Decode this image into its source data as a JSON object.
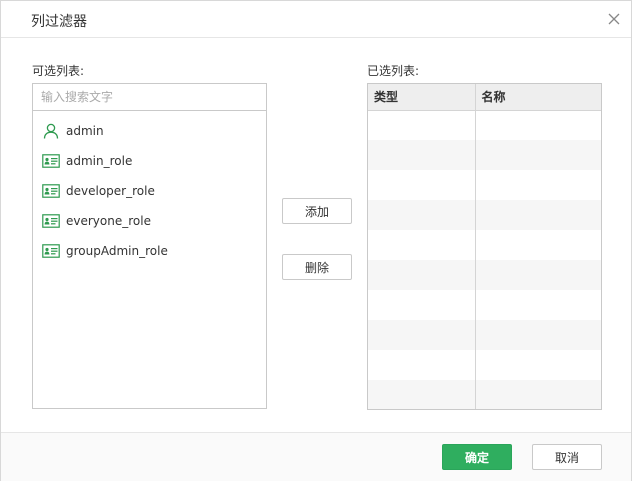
{
  "dialog": {
    "title": "列过滤器",
    "close_icon": "close-icon"
  },
  "available": {
    "label": "可选列表:",
    "search_placeholder": "输入搜索文字",
    "search_value": "",
    "items": [
      {
        "label": "admin",
        "icon": "user-icon"
      },
      {
        "label": "admin_role",
        "icon": "role-card-icon"
      },
      {
        "label": "developer_role",
        "icon": "role-card-icon"
      },
      {
        "label": "everyone_role",
        "icon": "role-card-icon"
      },
      {
        "label": "groupAdmin_role",
        "icon": "role-card-icon"
      }
    ]
  },
  "actions": {
    "add_label": "添加",
    "delete_label": "删除"
  },
  "selected": {
    "label": "已选列表:",
    "columns": [
      "类型",
      "名称"
    ],
    "rows": []
  },
  "footer": {
    "ok_label": "确定",
    "cancel_label": "取消"
  },
  "colors": {
    "accent": "#2fae5f",
    "icon_green": "#2e9a4f"
  }
}
